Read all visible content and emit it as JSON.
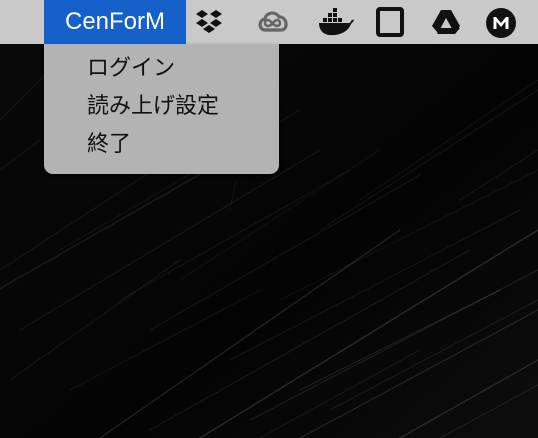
{
  "menubar": {
    "app_name": "CenForM",
    "app_highlight_color": "#1560c9",
    "bar_color": "#c9c9c9",
    "tray_icons": [
      "dropbox-icon",
      "creative-cloud-icon",
      "docker-icon",
      "square-frame-icon",
      "google-drive-icon",
      "mega-icon"
    ]
  },
  "dropdown": {
    "background_color": "#b3b3b3",
    "items": [
      {
        "label": "ログイン"
      },
      {
        "label": "読み上げ設定"
      },
      {
        "label": "終了"
      }
    ]
  }
}
